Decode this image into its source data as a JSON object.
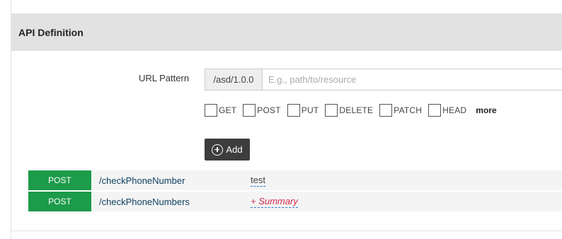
{
  "section": {
    "title": "API Definition"
  },
  "url_pattern": {
    "label": "URL Pattern",
    "prefix": "/asd/1.0.0",
    "placeholder": "E.g., path/to/resource",
    "value": ""
  },
  "methods": [
    {
      "label": "GET",
      "checked": false
    },
    {
      "label": "POST",
      "checked": false
    },
    {
      "label": "PUT",
      "checked": false
    },
    {
      "label": "DELETE",
      "checked": false
    },
    {
      "label": "PATCH",
      "checked": false
    },
    {
      "label": "HEAD",
      "checked": false
    }
  ],
  "more_label": "more",
  "add_button": {
    "label": "Add",
    "icon": "plus-circle-icon"
  },
  "resources": [
    {
      "verb": "POST",
      "path": "/checkPhoneNumber",
      "summary": "test"
    },
    {
      "verb": "POST",
      "path": "/checkPhoneNumbers",
      "summary": "+ Summary"
    }
  ],
  "colors": {
    "verb_post": "#1c9b4a",
    "heading_bg": "#e2e2e2",
    "add_button_bg": "#3d3d3d",
    "summary_placeholder": "#d0284b"
  }
}
